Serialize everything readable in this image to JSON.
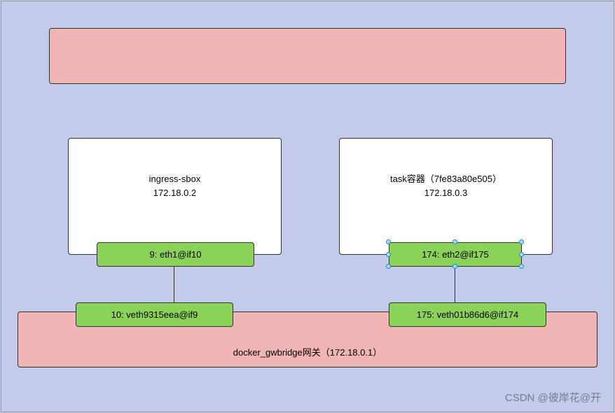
{
  "boxes": {
    "left": {
      "title": "ingress-sbox",
      "ip": "172.18.0.2"
    },
    "right": {
      "title": "task容器（7fe83a80e505）",
      "ip": "172.18.0.3"
    }
  },
  "veth": {
    "eth1": "9: eth1@if10",
    "eth2": "174: eth2@if175",
    "veth1": "10: veth9315eea@if9",
    "veth2": "175: veth01b86d6@if174"
  },
  "gwbridge": {
    "label": "docker_gwbridge网关（172.18.0.1）"
  },
  "watermark": "CSDN @彼岸花@开"
}
